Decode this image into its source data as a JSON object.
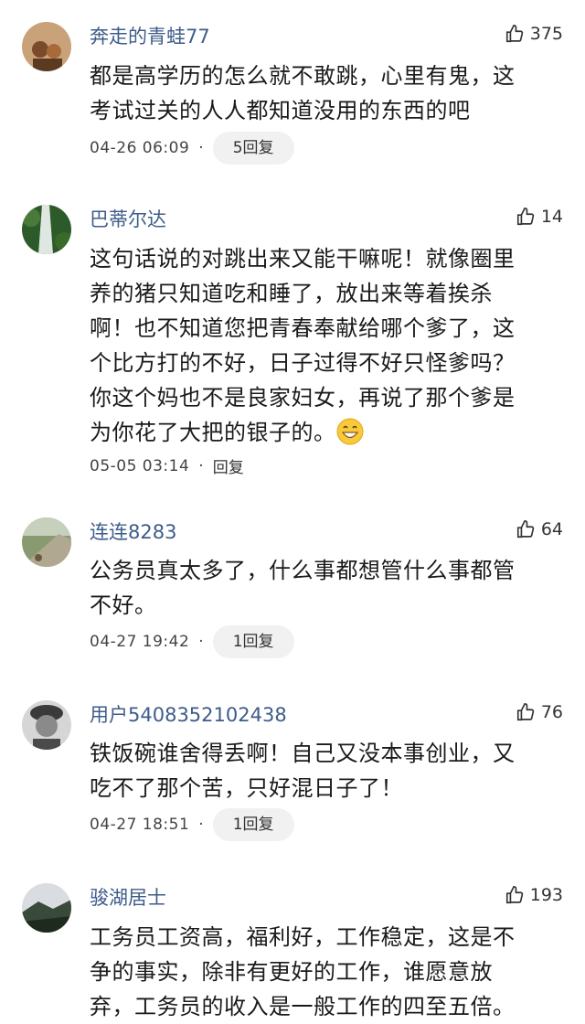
{
  "comments": [
    {
      "user": "奔走的青蛙77",
      "likes": "375",
      "lines": [
        "都是高学历的怎么就不敢跳，心里有鬼，这",
        "考试过关的人人都知道没用的东西的吧"
      ],
      "time": "04-26 06:09",
      "reply": "5回复"
    },
    {
      "user": "巴蒂尔达",
      "likes": "14",
      "lines": [
        "这句话说的对跳出来又能干嘛呢！就像圈里",
        "养的猪只知道吃和睡了，放出来等着挨杀",
        "啊！也不知道您把青春奉献给哪个爹了，这",
        "个比方打的不好，日子过得不好只怪爹吗？",
        "你这个妈也不是良家妇女，再说了那个爹是",
        "为你花了大把的银子的。"
      ],
      "time": "05-05 03:14",
      "dot": "·",
      "reply": "回复"
    },
    {
      "user": "连连8283",
      "likes": "64",
      "lines": [
        "公务员真太多了，什么事都想管什么事都管",
        "不好。"
      ],
      "time": "04-27 19:42",
      "dot": "·",
      "reply": "1回复"
    },
    {
      "user": "用户5408352102438",
      "likes": "76",
      "lines": [
        "铁饭碗谁舍得丢啊！自己又没本事创业，又",
        "吃不了那个苦，只好混日子了！"
      ],
      "time": "04-27 18:51",
      "dot": "·",
      "reply": "1回复"
    },
    {
      "user": "骏湖居士",
      "likes": "193",
      "lines": [
        "工务员工资高，福利好，工作稳定，这是不",
        "争的事实，除非有更好的工作，谁愿意放",
        "弃，工务员的收入是一般工作的四至五倍。"
      ]
    }
  ],
  "icons": {
    "like": "thumbs-up-icon",
    "emoji": "grinning-face-icon"
  }
}
